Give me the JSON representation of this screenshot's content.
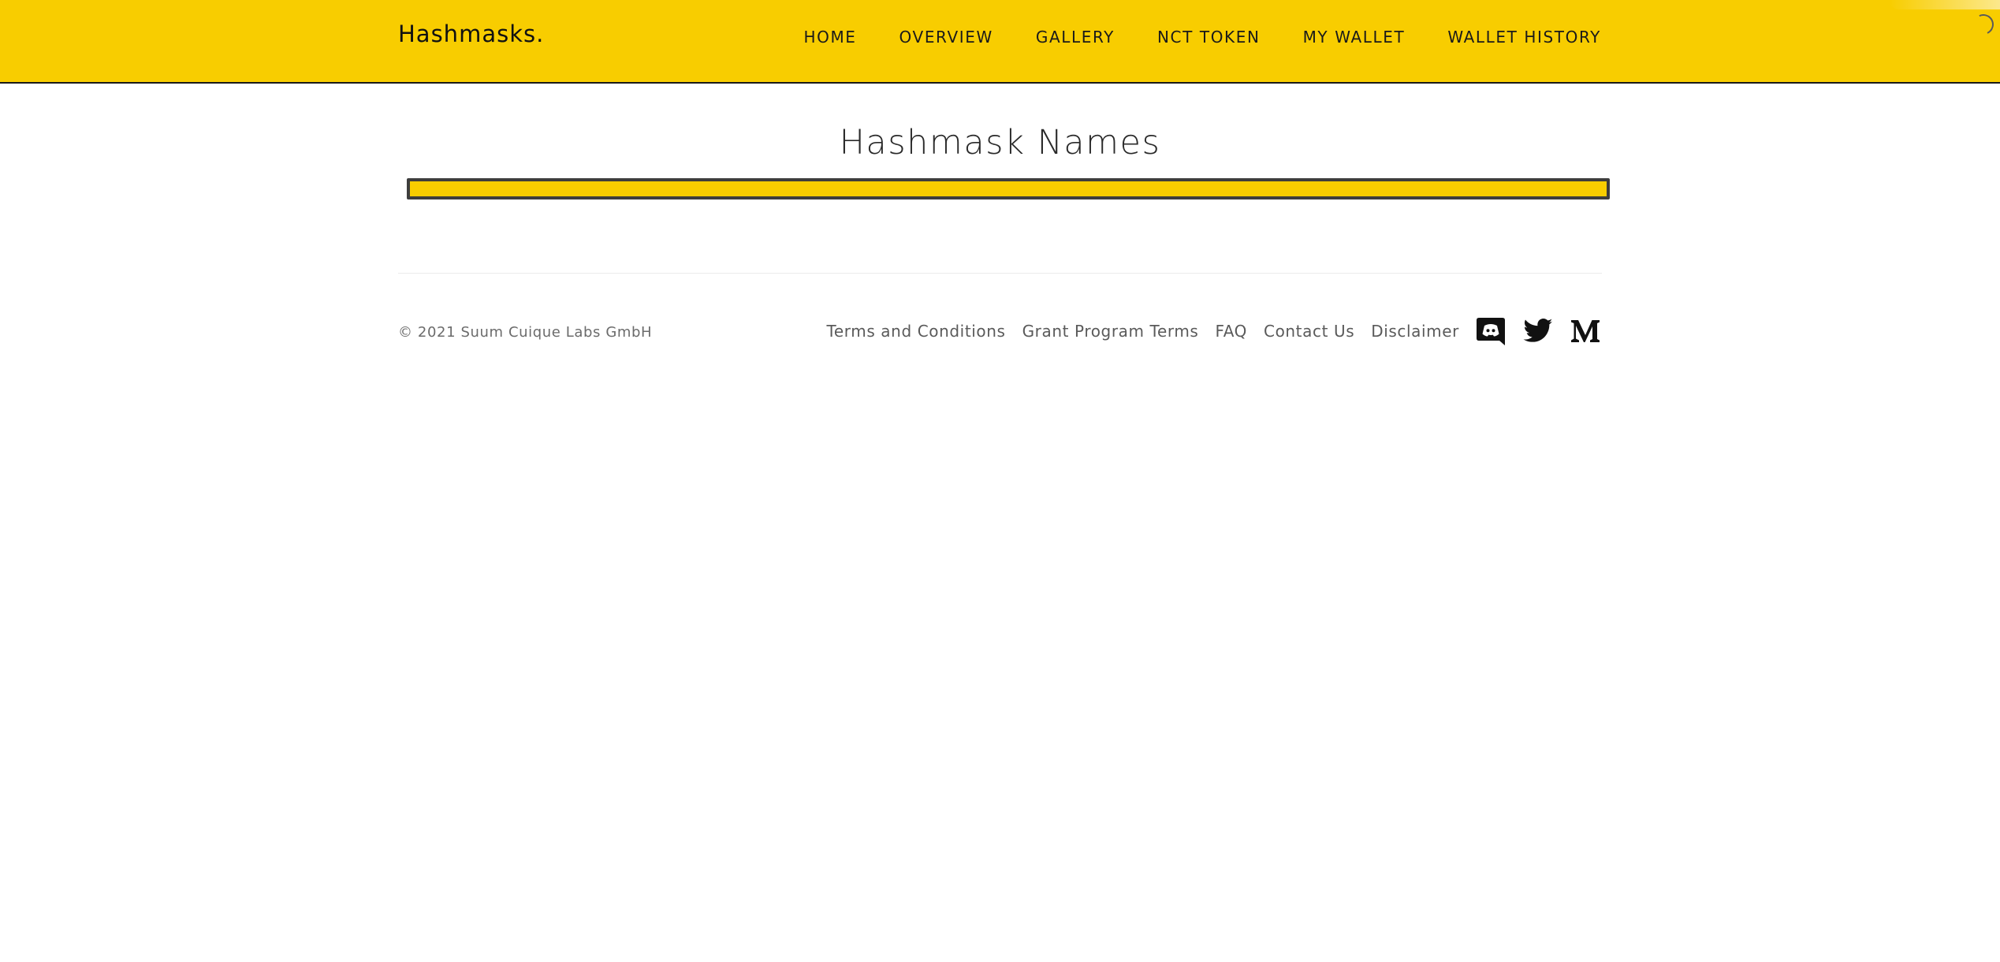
{
  "brand": {
    "name": "Hashmasks."
  },
  "nav": {
    "items": [
      {
        "label": "HOME"
      },
      {
        "label": "OVERVIEW"
      },
      {
        "label": "GALLERY"
      },
      {
        "label": "NCT TOKEN"
      },
      {
        "label": "MY WALLET"
      },
      {
        "label": "WALLET HISTORY"
      }
    ]
  },
  "main": {
    "title": "Hashmask Names",
    "progress_fraction": 1.0
  },
  "footer": {
    "copyright": "© 2021 Suum Cuique Labs GmbH",
    "links": [
      {
        "label": "Terms and Conditions"
      },
      {
        "label": "Grant Program Terms"
      },
      {
        "label": "FAQ"
      },
      {
        "label": "Contact Us"
      },
      {
        "label": "Disclaimer"
      }
    ],
    "social_icons": [
      "discord-icon",
      "twitter-icon",
      "medium-icon"
    ]
  },
  "colors": {
    "brand_yellow": "#f8cd00",
    "progress_border": "#3d3d3d",
    "text_dark": "#222222"
  }
}
